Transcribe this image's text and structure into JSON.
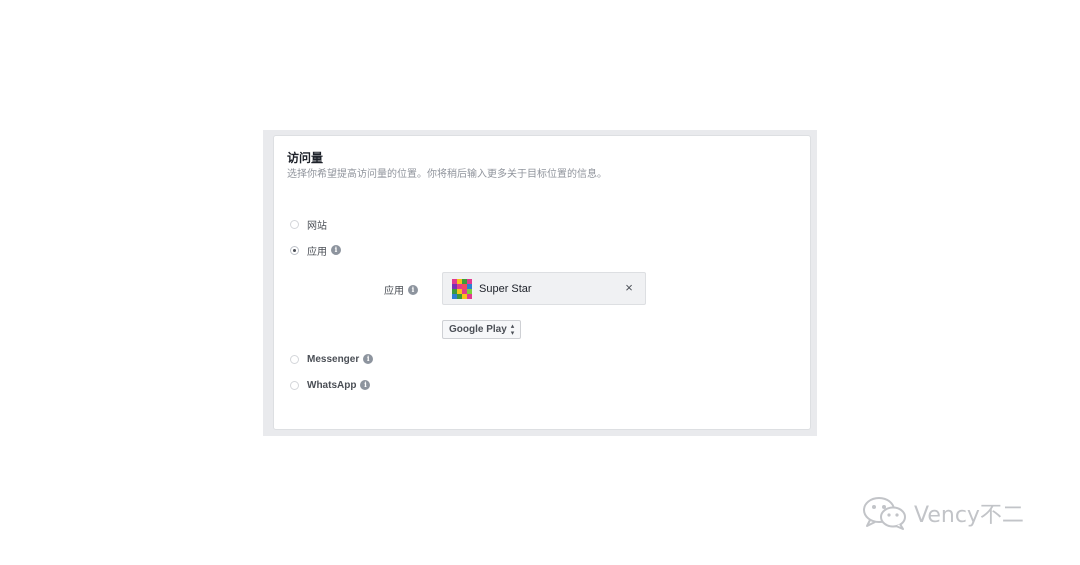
{
  "section": {
    "title": "访问量",
    "subtitle": "选择你希望提高访问量的位置。你将稍后输入更多关于目标位置的信息。"
  },
  "options": [
    {
      "label": "网站",
      "selected": false,
      "info": false
    },
    {
      "label": "应用",
      "selected": true,
      "info": true
    },
    {
      "label": "Messenger",
      "selected": false,
      "info": true
    },
    {
      "label": "WhatsApp",
      "selected": false,
      "info": true
    }
  ],
  "app_field": {
    "label": "应用",
    "value": "Super Star",
    "clear_symbol": "×"
  },
  "store_select": {
    "value": "Google Play"
  },
  "icons": {
    "info": "info-icon",
    "clear": "close-icon",
    "select": "up-down-chevron-icon"
  },
  "watermark": {
    "text": "Vency不二",
    "icon": "wechat-icon"
  },
  "colors": {
    "frame": "#e9eaed",
    "field_bg": "#f0f1f3",
    "text_muted": "#90949c",
    "watermark": "#c2c4c8"
  }
}
